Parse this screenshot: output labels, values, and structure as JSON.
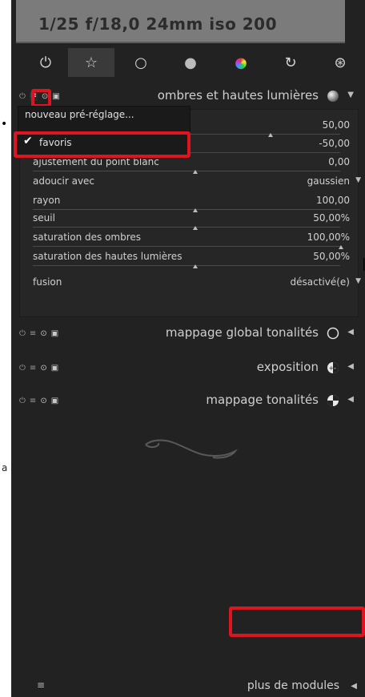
{
  "image_info": {
    "text": "1/25 f/18,0 24mm iso 200"
  },
  "tabs": [
    {
      "name": "tab-power",
      "glyph": "⏻"
    },
    {
      "name": "tab-favorites",
      "glyph": "☆"
    },
    {
      "name": "tab-base",
      "glyph": "○"
    },
    {
      "name": "tab-tone",
      "glyph": "●"
    },
    {
      "name": "tab-color",
      "glyph": "●"
    },
    {
      "name": "tab-correct",
      "glyph": "↻"
    },
    {
      "name": "tab-effect",
      "glyph": "⊛"
    }
  ],
  "modules": [
    {
      "name": "ombres et hautes lumières",
      "icon": "sphere-icon",
      "expanded": true
    },
    {
      "name": "mappage global tonalités",
      "icon": "circle-icon"
    },
    {
      "name": "exposition",
      "icon": "exposure-icon"
    },
    {
      "name": "mappage tonalités",
      "icon": "tonemap-icon"
    }
  ],
  "preset_menu": {
    "new_preset": "nouveau pré-réglage...",
    "favorites": "favoris"
  },
  "params": [
    {
      "label": "",
      "value": "50,00",
      "level": 0.75
    },
    {
      "label": "",
      "value": "-50,00",
      "level": 0.25
    },
    {
      "label": "ajustement du point blanc",
      "value": "0,00",
      "level": 0.5
    },
    {
      "label": "adoucir avec",
      "value": "gaussien",
      "dropdown": true
    },
    {
      "label": "rayon",
      "value": "100,00",
      "level": 0.5
    },
    {
      "label": "seuil",
      "value": "50,00%",
      "level": 0.5
    },
    {
      "label": "saturation des ombres",
      "value": "100,00%",
      "level": 1.0
    },
    {
      "label": "saturation des hautes lumières",
      "value": "50,00%",
      "level": 0.5
    },
    {
      "label": "fusion",
      "value": "désactivé(e)",
      "dropdown": true
    }
  ],
  "footer": {
    "menu_glyph": "≡",
    "more_modules": "plus de modules"
  },
  "accent_color": "#e0141f"
}
